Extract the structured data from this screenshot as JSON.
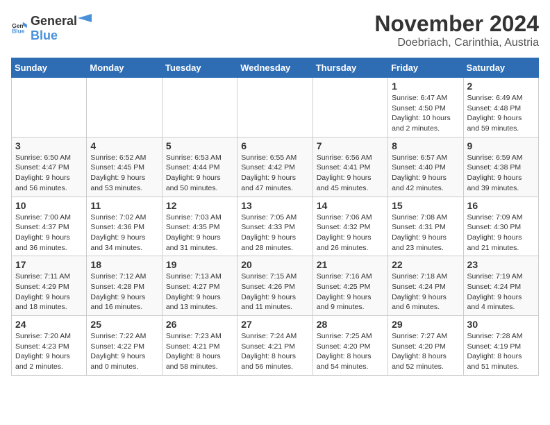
{
  "header": {
    "logo_general": "General",
    "logo_blue": "Blue",
    "month_title": "November 2024",
    "location": "Doebriach, Carinthia, Austria"
  },
  "weekdays": [
    "Sunday",
    "Monday",
    "Tuesday",
    "Wednesday",
    "Thursday",
    "Friday",
    "Saturday"
  ],
  "weeks": [
    [
      {
        "day": "",
        "info": ""
      },
      {
        "day": "",
        "info": ""
      },
      {
        "day": "",
        "info": ""
      },
      {
        "day": "",
        "info": ""
      },
      {
        "day": "",
        "info": ""
      },
      {
        "day": "1",
        "info": "Sunrise: 6:47 AM\nSunset: 4:50 PM\nDaylight: 10 hours and 2 minutes."
      },
      {
        "day": "2",
        "info": "Sunrise: 6:49 AM\nSunset: 4:48 PM\nDaylight: 9 hours and 59 minutes."
      }
    ],
    [
      {
        "day": "3",
        "info": "Sunrise: 6:50 AM\nSunset: 4:47 PM\nDaylight: 9 hours and 56 minutes."
      },
      {
        "day": "4",
        "info": "Sunrise: 6:52 AM\nSunset: 4:45 PM\nDaylight: 9 hours and 53 minutes."
      },
      {
        "day": "5",
        "info": "Sunrise: 6:53 AM\nSunset: 4:44 PM\nDaylight: 9 hours and 50 minutes."
      },
      {
        "day": "6",
        "info": "Sunrise: 6:55 AM\nSunset: 4:42 PM\nDaylight: 9 hours and 47 minutes."
      },
      {
        "day": "7",
        "info": "Sunrise: 6:56 AM\nSunset: 4:41 PM\nDaylight: 9 hours and 45 minutes."
      },
      {
        "day": "8",
        "info": "Sunrise: 6:57 AM\nSunset: 4:40 PM\nDaylight: 9 hours and 42 minutes."
      },
      {
        "day": "9",
        "info": "Sunrise: 6:59 AM\nSunset: 4:38 PM\nDaylight: 9 hours and 39 minutes."
      }
    ],
    [
      {
        "day": "10",
        "info": "Sunrise: 7:00 AM\nSunset: 4:37 PM\nDaylight: 9 hours and 36 minutes."
      },
      {
        "day": "11",
        "info": "Sunrise: 7:02 AM\nSunset: 4:36 PM\nDaylight: 9 hours and 34 minutes."
      },
      {
        "day": "12",
        "info": "Sunrise: 7:03 AM\nSunset: 4:35 PM\nDaylight: 9 hours and 31 minutes."
      },
      {
        "day": "13",
        "info": "Sunrise: 7:05 AM\nSunset: 4:33 PM\nDaylight: 9 hours and 28 minutes."
      },
      {
        "day": "14",
        "info": "Sunrise: 7:06 AM\nSunset: 4:32 PM\nDaylight: 9 hours and 26 minutes."
      },
      {
        "day": "15",
        "info": "Sunrise: 7:08 AM\nSunset: 4:31 PM\nDaylight: 9 hours and 23 minutes."
      },
      {
        "day": "16",
        "info": "Sunrise: 7:09 AM\nSunset: 4:30 PM\nDaylight: 9 hours and 21 minutes."
      }
    ],
    [
      {
        "day": "17",
        "info": "Sunrise: 7:11 AM\nSunset: 4:29 PM\nDaylight: 9 hours and 18 minutes."
      },
      {
        "day": "18",
        "info": "Sunrise: 7:12 AM\nSunset: 4:28 PM\nDaylight: 9 hours and 16 minutes."
      },
      {
        "day": "19",
        "info": "Sunrise: 7:13 AM\nSunset: 4:27 PM\nDaylight: 9 hours and 13 minutes."
      },
      {
        "day": "20",
        "info": "Sunrise: 7:15 AM\nSunset: 4:26 PM\nDaylight: 9 hours and 11 minutes."
      },
      {
        "day": "21",
        "info": "Sunrise: 7:16 AM\nSunset: 4:25 PM\nDaylight: 9 hours and 9 minutes."
      },
      {
        "day": "22",
        "info": "Sunrise: 7:18 AM\nSunset: 4:24 PM\nDaylight: 9 hours and 6 minutes."
      },
      {
        "day": "23",
        "info": "Sunrise: 7:19 AM\nSunset: 4:24 PM\nDaylight: 9 hours and 4 minutes."
      }
    ],
    [
      {
        "day": "24",
        "info": "Sunrise: 7:20 AM\nSunset: 4:23 PM\nDaylight: 9 hours and 2 minutes."
      },
      {
        "day": "25",
        "info": "Sunrise: 7:22 AM\nSunset: 4:22 PM\nDaylight: 9 hours and 0 minutes."
      },
      {
        "day": "26",
        "info": "Sunrise: 7:23 AM\nSunset: 4:21 PM\nDaylight: 8 hours and 58 minutes."
      },
      {
        "day": "27",
        "info": "Sunrise: 7:24 AM\nSunset: 4:21 PM\nDaylight: 8 hours and 56 minutes."
      },
      {
        "day": "28",
        "info": "Sunrise: 7:25 AM\nSunset: 4:20 PM\nDaylight: 8 hours and 54 minutes."
      },
      {
        "day": "29",
        "info": "Sunrise: 7:27 AM\nSunset: 4:20 PM\nDaylight: 8 hours and 52 minutes."
      },
      {
        "day": "30",
        "info": "Sunrise: 7:28 AM\nSunset: 4:19 PM\nDaylight: 8 hours and 51 minutes."
      }
    ]
  ]
}
